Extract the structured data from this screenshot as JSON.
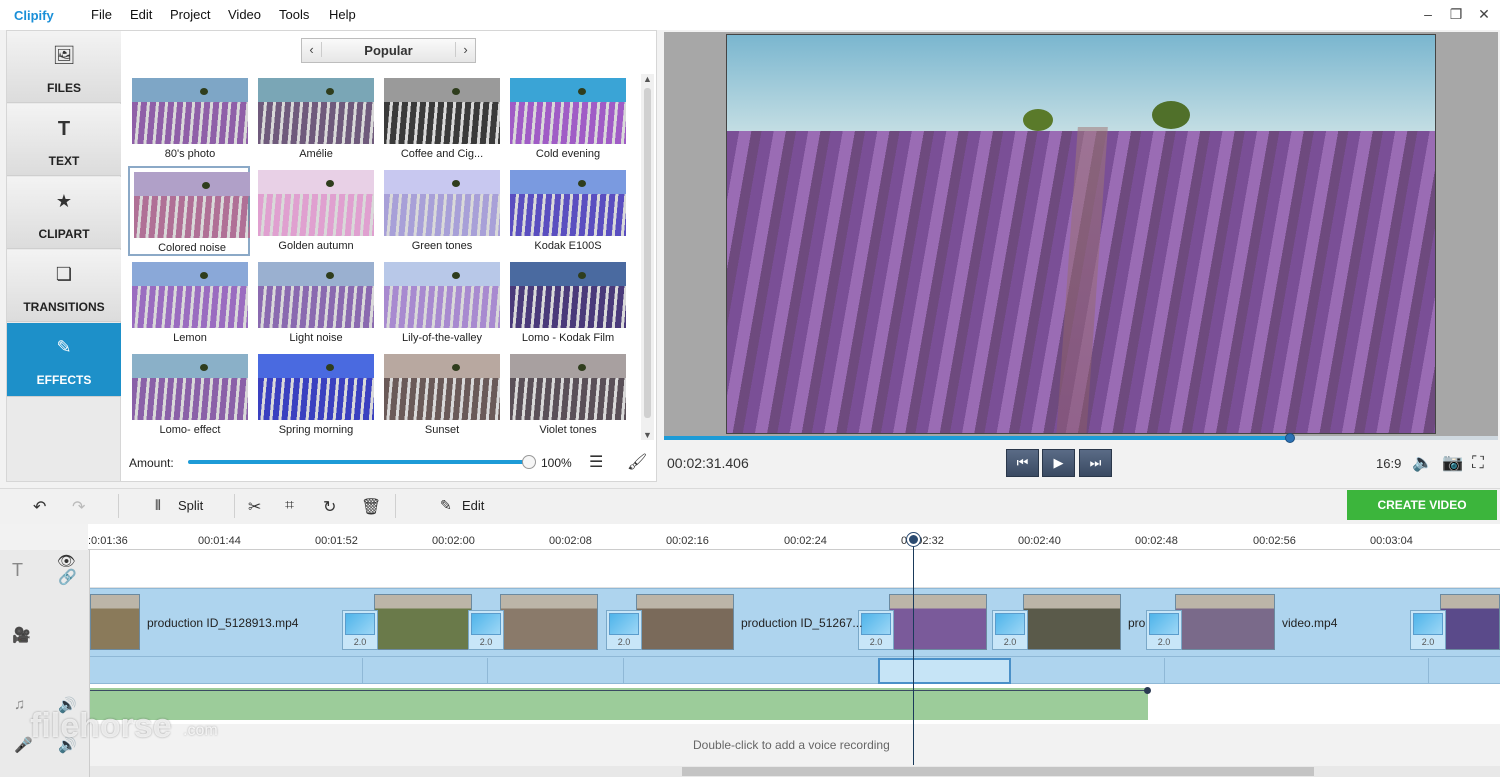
{
  "app": {
    "name": "Clipify"
  },
  "menu": [
    "File",
    "Edit",
    "Project",
    "Video",
    "Tools",
    "Help"
  ],
  "sidebar": {
    "items": [
      {
        "label": "FILES",
        "icon": "image-icon"
      },
      {
        "label": "TEXT",
        "icon": "text-icon"
      },
      {
        "label": "CLIPART",
        "icon": "star-icon"
      },
      {
        "label": "TRANSITIONS",
        "icon": "transitions-icon"
      },
      {
        "label": "EFFECTS",
        "icon": "effects-icon"
      }
    ]
  },
  "effects": {
    "category": "Popular",
    "items": [
      "80's photo",
      "Amélie",
      "Coffee and Cig...",
      "Cold evening",
      "Colored noise",
      "Golden autumn",
      "Green tones",
      "Kodak E100S",
      "Lemon",
      "Light noise",
      "Lily-of-the-valley",
      "Lomo - Kodak Film",
      "Lomo- effect",
      "Spring morning",
      "Sunset",
      "Violet tones"
    ],
    "selected": "Colored noise",
    "amount_label": "Amount:",
    "amount_value": "100%",
    "amount_fraction": 1.0
  },
  "player": {
    "timecode": "00:02:31.406",
    "ratio": "16:9",
    "progress_fraction": 0.75
  },
  "toolbar": {
    "split_label": "Split",
    "edit_label": "Edit",
    "create_label": "CREATE VIDEO"
  },
  "timeline": {
    "ruler_ticks": [
      ":0:01:36",
      "00:01:44",
      "00:01:52",
      "00:02:00",
      "00:02:08",
      "00:02:16",
      "00:02:24",
      "00:02:32",
      "00:02:40",
      "00:02:48",
      "00:02:56",
      "00:03:04"
    ],
    "clips": [
      {
        "name": "production ID_5128913.mp4"
      },
      {
        "name": "production ID_51267..."
      },
      {
        "name": "pro"
      },
      {
        "name": "video.mp4"
      }
    ],
    "transition_duration": "2.0",
    "voice_hint": "Double-click to add a voice recording"
  },
  "watermark": {
    "text": "filehorse",
    "domain": ".com"
  }
}
